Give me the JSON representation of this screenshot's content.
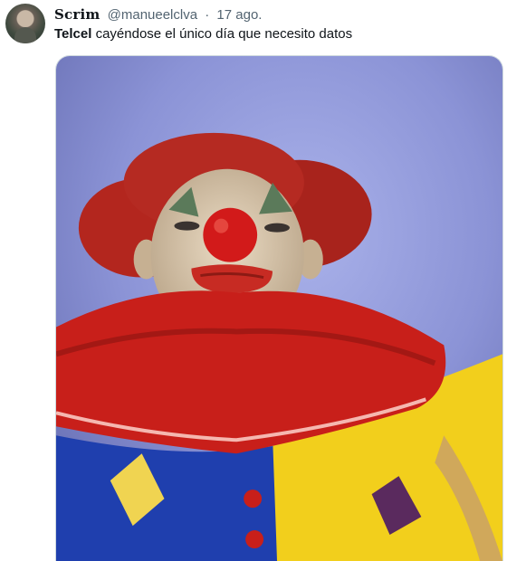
{
  "tweet": {
    "display_name": "Scrim",
    "handle": "@manueelclva",
    "separator": "·",
    "time": "17 ago.",
    "text_bold": "Telcel",
    "text_rest": " cayéndose el único día que necesito datos"
  },
  "media": {
    "subject": "clown-photo",
    "colors": {
      "background": "#8b93d6",
      "wig": "#b3261e",
      "collar": "#c81f1a",
      "suit_blue": "#1f3fae",
      "suit_yellow": "#f2cf1c",
      "face": "#d9c7ad",
      "nose": "#d21a1a"
    }
  }
}
